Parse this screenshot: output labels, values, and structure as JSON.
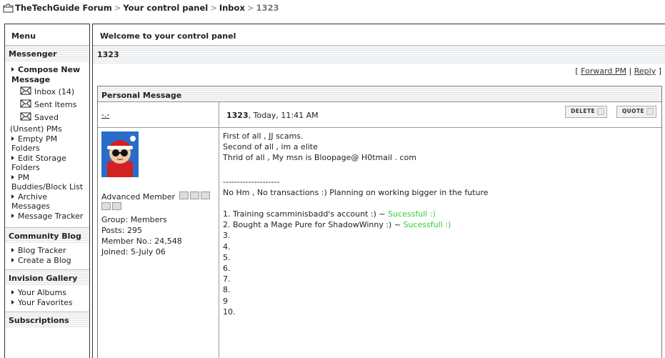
{
  "breadcrumb": {
    "forum": "TheTechGuide Forum",
    "sep1": ">",
    "control_panel": "Your control panel",
    "sep2": ">",
    "inbox": "Inbox",
    "sep3": ">",
    "current": "1323"
  },
  "sidebar": {
    "title": "Menu",
    "messenger": {
      "heading": "Messenger",
      "compose": "Compose New Message",
      "inbox": "Inbox (14)",
      "sent": "Sent Items",
      "saved": "Saved",
      "unsent": "(Unsent) PMs",
      "empty": "Empty PM Folders",
      "edit_storage": "Edit Storage Folders",
      "buddies": "PM Buddies/Block List",
      "archive": "Archive Messages",
      "tracker": "Message Tracker"
    },
    "blog": {
      "heading": "Community Blog",
      "tracker": "Blog Tracker",
      "create": "Create a Blog"
    },
    "gallery": {
      "heading": "Invision Gallery",
      "albums": "Your Albums",
      "favorites": "Your Favorites"
    },
    "subscriptions": {
      "heading": "Subscriptions"
    }
  },
  "main": {
    "welcome": "Welcome to your control panel",
    "pm_id": "1323",
    "actions": {
      "open": "[",
      "forward": "Forward PM",
      "sep": "|",
      "reply": "Reply",
      "close": "]"
    },
    "pm_heading": "Personal Message",
    "author_link": "-.-",
    "meta": {
      "id": "1323",
      "date": ", Today, 11:41 AM"
    },
    "buttons": {
      "delete": "DELETE",
      "quote": "QUOTE"
    },
    "profile": {
      "rank": "Advanced Member",
      "group": "Group: Members",
      "posts": "Posts: 295",
      "member_no": "Member No.: 24,548",
      "joined": "Joined: 5-July 06"
    },
    "message": {
      "l1": "First of all , JJ scams.",
      "l2": "Second of all , im a elite",
      "l3": "Thrid of all , My msn is Bloopage@ H0tmail . com",
      "divider": "--------------------",
      "l4": "No Hm , No transactions :) Planning on working bigger in the future",
      "i1": "1. Training scamminisbadd's account :) ~",
      "i1s": "Sucessfull :)",
      "i2": "2. Bought a Mage Pure for ShadowWinny :) ~",
      "i2s": "Sucessfull :)",
      "i3": "3.",
      "i4": "4.",
      "i5": "5.",
      "i6": "6.",
      "i7": "7.",
      "i8": "8.",
      "i9": "9",
      "i10": "10."
    }
  },
  "colors": {
    "success": "#33cc33",
    "border": "#333333"
  }
}
